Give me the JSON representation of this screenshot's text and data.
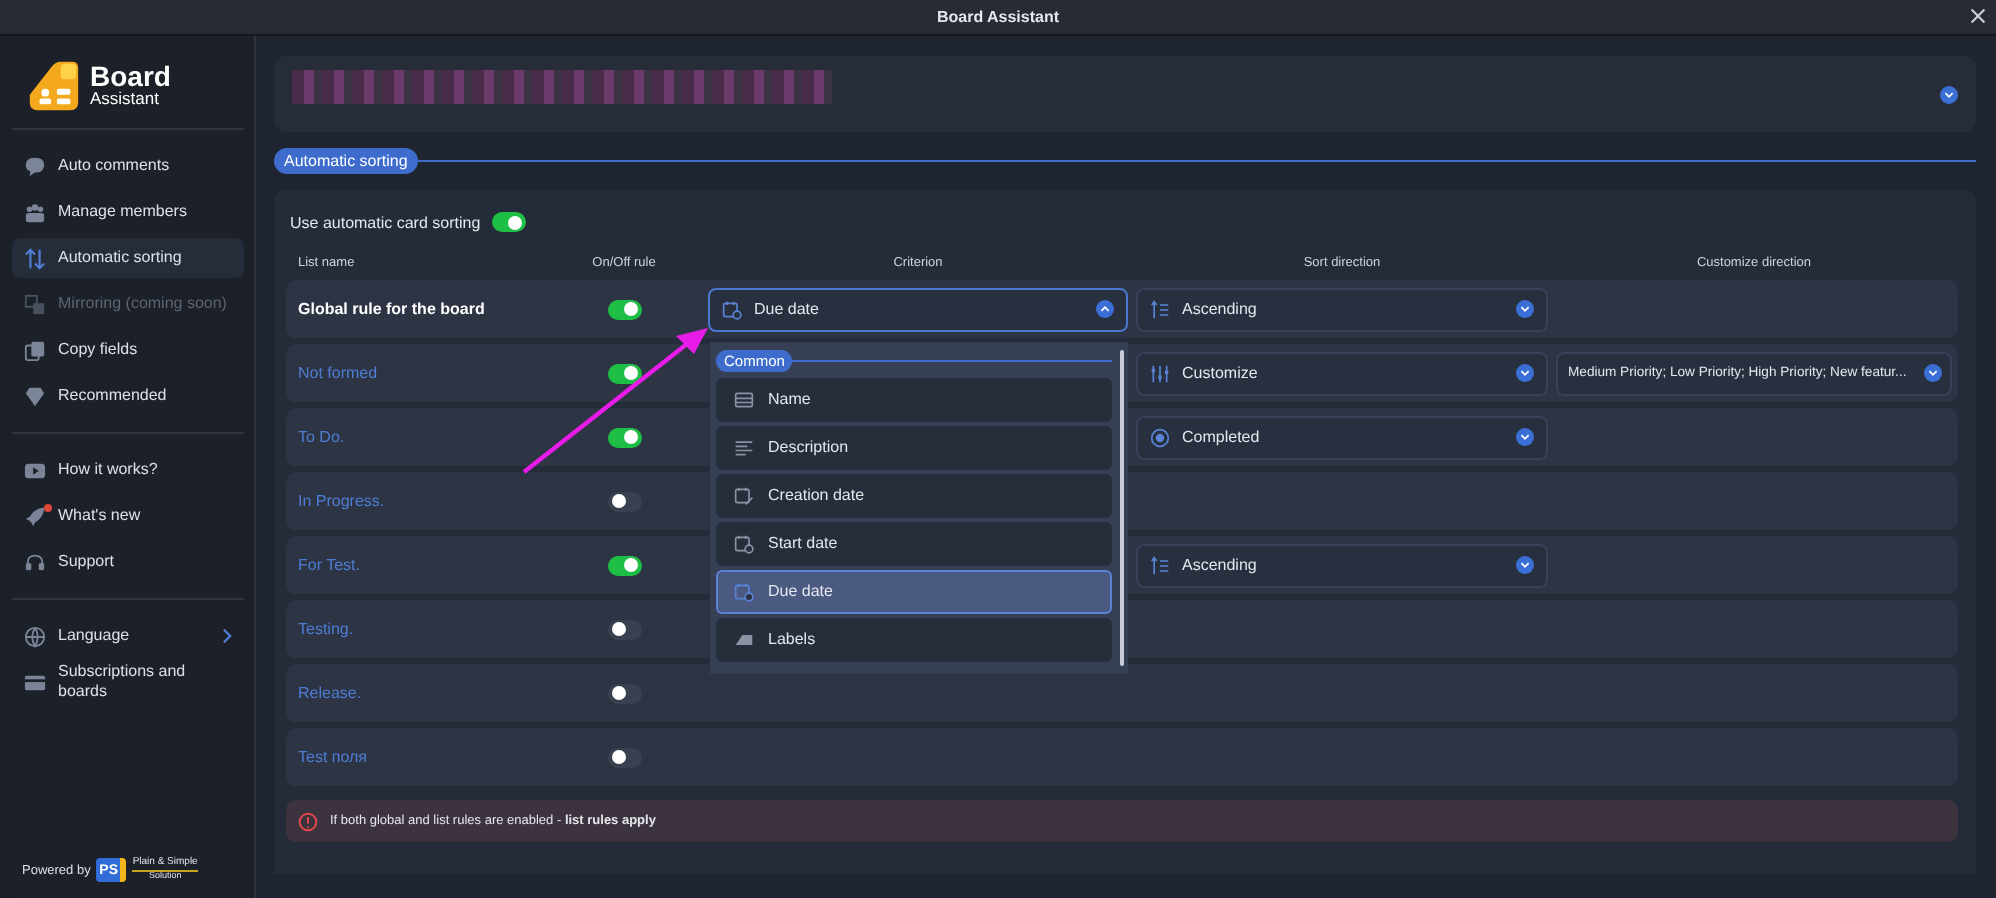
{
  "window": {
    "title": "Board Assistant"
  },
  "sidebar": {
    "logo": {
      "title": "Board",
      "subtitle": "Assistant"
    },
    "groups": [
      [
        {
          "label": "Auto comments",
          "selected": false,
          "disabled": false,
          "notification": false,
          "submenu": false
        },
        {
          "label": "Manage members",
          "selected": false,
          "disabled": false,
          "notification": false,
          "submenu": false
        },
        {
          "label": "Automatic sorting",
          "selected": true,
          "disabled": false,
          "notification": false,
          "submenu": false
        },
        {
          "label": "Mirroring (coming soon)",
          "selected": false,
          "disabled": true,
          "notification": false,
          "submenu": false
        },
        {
          "label": "Copy fields",
          "selected": false,
          "disabled": false,
          "notification": false,
          "submenu": false
        },
        {
          "label": "Recommended",
          "selected": false,
          "disabled": false,
          "notification": false,
          "submenu": false
        }
      ],
      [
        {
          "label": "How it works?",
          "selected": false,
          "disabled": false,
          "notification": false,
          "submenu": false
        },
        {
          "label": "What's new",
          "selected": false,
          "disabled": false,
          "notification": true,
          "submenu": false
        },
        {
          "label": "Support",
          "selected": false,
          "disabled": false,
          "notification": false,
          "submenu": false
        }
      ],
      [
        {
          "label": "Language",
          "selected": false,
          "disabled": false,
          "notification": false,
          "submenu": true
        },
        {
          "label": "Subscriptions and boards",
          "selected": false,
          "disabled": false,
          "notification": false,
          "submenu": false
        }
      ]
    ],
    "footer": {
      "powered_by": "Powered by",
      "partner_mark": "PS",
      "partner_name": "Plain & Simple",
      "partner_sub": "Solution"
    }
  },
  "section_label": "Automatic sorting",
  "master_toggle": {
    "label": "Use automatic card sorting",
    "on": true
  },
  "columns": [
    "List name",
    "On/Off rule",
    "Criterion",
    "Sort direction",
    "Customize direction"
  ],
  "rows": [
    {
      "name": "Global rule for the board",
      "kind": "global",
      "on": true,
      "criterion": {
        "label": "Due date",
        "expanded": true
      },
      "sort": {
        "label": "Ascending",
        "kind": "ascending"
      }
    },
    {
      "name": "Not formed",
      "kind": "list",
      "on": true,
      "sort": {
        "label": "Customize",
        "kind": "custom"
      },
      "customize": {
        "label": "Medium Priority; Low Priority; High Priority; New featur..."
      }
    },
    {
      "name": "To Do.",
      "kind": "list",
      "on": true,
      "sort": {
        "label": "Completed",
        "kind": "status"
      }
    },
    {
      "name": "In Progress.",
      "kind": "list",
      "on": false
    },
    {
      "name": "For Test.",
      "kind": "list",
      "on": true,
      "sort": {
        "label": "Ascending",
        "kind": "ascending"
      }
    },
    {
      "name": "Testing.",
      "kind": "list",
      "on": false
    },
    {
      "name": "Release.",
      "kind": "list",
      "on": false
    },
    {
      "name": "Test поля",
      "kind": "list",
      "on": false
    }
  ],
  "criterion_dropdown": {
    "group": "Common",
    "items": [
      {
        "label": "Name",
        "selected": false
      },
      {
        "label": "Description",
        "selected": false
      },
      {
        "label": "Creation date",
        "selected": false
      },
      {
        "label": "Start date",
        "selected": false
      },
      {
        "label": "Due date",
        "selected": true
      },
      {
        "label": "Labels",
        "selected": false
      }
    ]
  },
  "notice": {
    "text": "If both global and list rules are enabled - **list rules apply**"
  }
}
